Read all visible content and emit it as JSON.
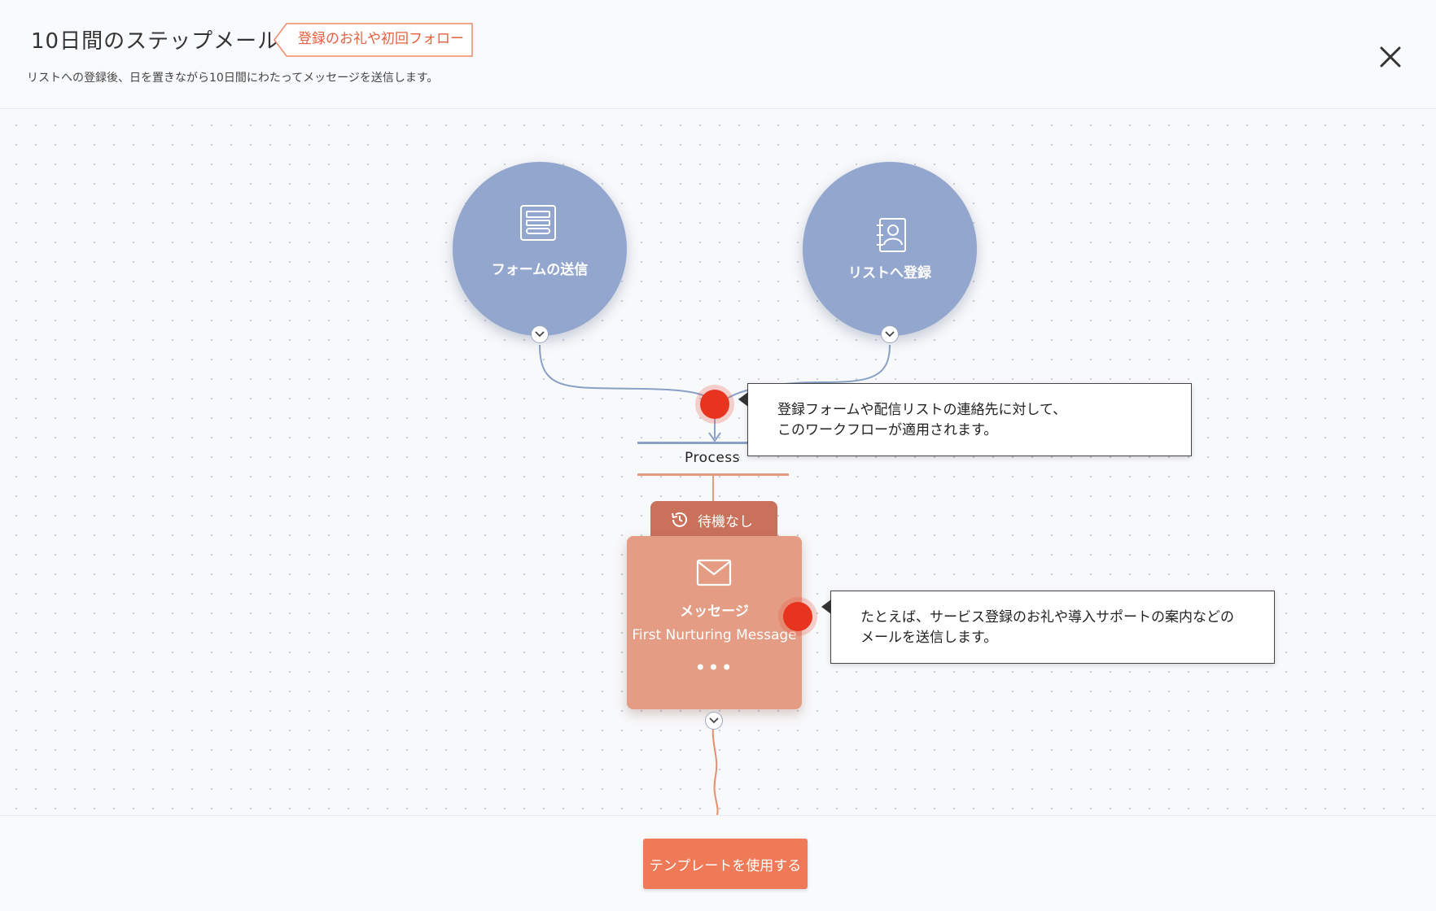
{
  "header": {
    "title": "10日間のステップメール",
    "tag": "登録のお礼や初回フォロー",
    "subtitle": "リストへの登録後、日を置きながら10日間にわたってメッセージを送信します。",
    "close_icon": "close-icon"
  },
  "triggers": [
    {
      "label": "フォームの送信",
      "icon": "form-icon"
    },
    {
      "label": "リストへ登録",
      "icon": "contact-list-icon"
    }
  ],
  "callouts": {
    "trigger": [
      "登録フォームや配信リストの連絡先に対して、",
      "このワークフローが適用されます。"
    ],
    "message": [
      "たとえば、サービス登録のお礼や導入サポートの案内などの",
      "メールを送信します。"
    ]
  },
  "process": {
    "label": "Process"
  },
  "step": {
    "wait_label": "待機なし",
    "type": "メッセージ",
    "name": "First Nurturing Message",
    "menu": "•••"
  },
  "footer": {
    "use_template_button": "テンプレートを使用する"
  },
  "colors": {
    "accent": "#ee7a57",
    "trigger_node": "#93a6cd",
    "message_node": "#e49d84",
    "wait_tab": "#c9715b",
    "hotspot": "#e8331f"
  }
}
